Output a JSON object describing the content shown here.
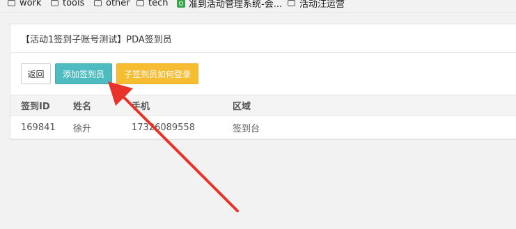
{
  "bookmarks": [
    {
      "label": "work",
      "icon": "folder-icon"
    },
    {
      "label": "tools",
      "icon": "folder-icon"
    },
    {
      "label": "other",
      "icon": "folder-icon"
    },
    {
      "label": "tech",
      "icon": "folder-icon"
    },
    {
      "label": "准到活动管理系统-会...",
      "icon": "site-icon"
    },
    {
      "label": "活动汪运营",
      "icon": "folder-icon"
    }
  ],
  "panel": {
    "title": "【活动1签到子账号测试】PDA签到员"
  },
  "toolbar": {
    "back_label": "返回",
    "add_label": "添加签到员",
    "how_label": "子签到员如何登录"
  },
  "table": {
    "headers": [
      "签到ID",
      "姓名",
      "手机",
      "区域"
    ],
    "rows": [
      [
        "169841",
        "徐升",
        "17326089558",
        "签到台"
      ]
    ]
  },
  "colors": {
    "add_button": "#4ebbc0",
    "how_button": "#f6bc32",
    "annotation_arrow": "#e8332a"
  }
}
